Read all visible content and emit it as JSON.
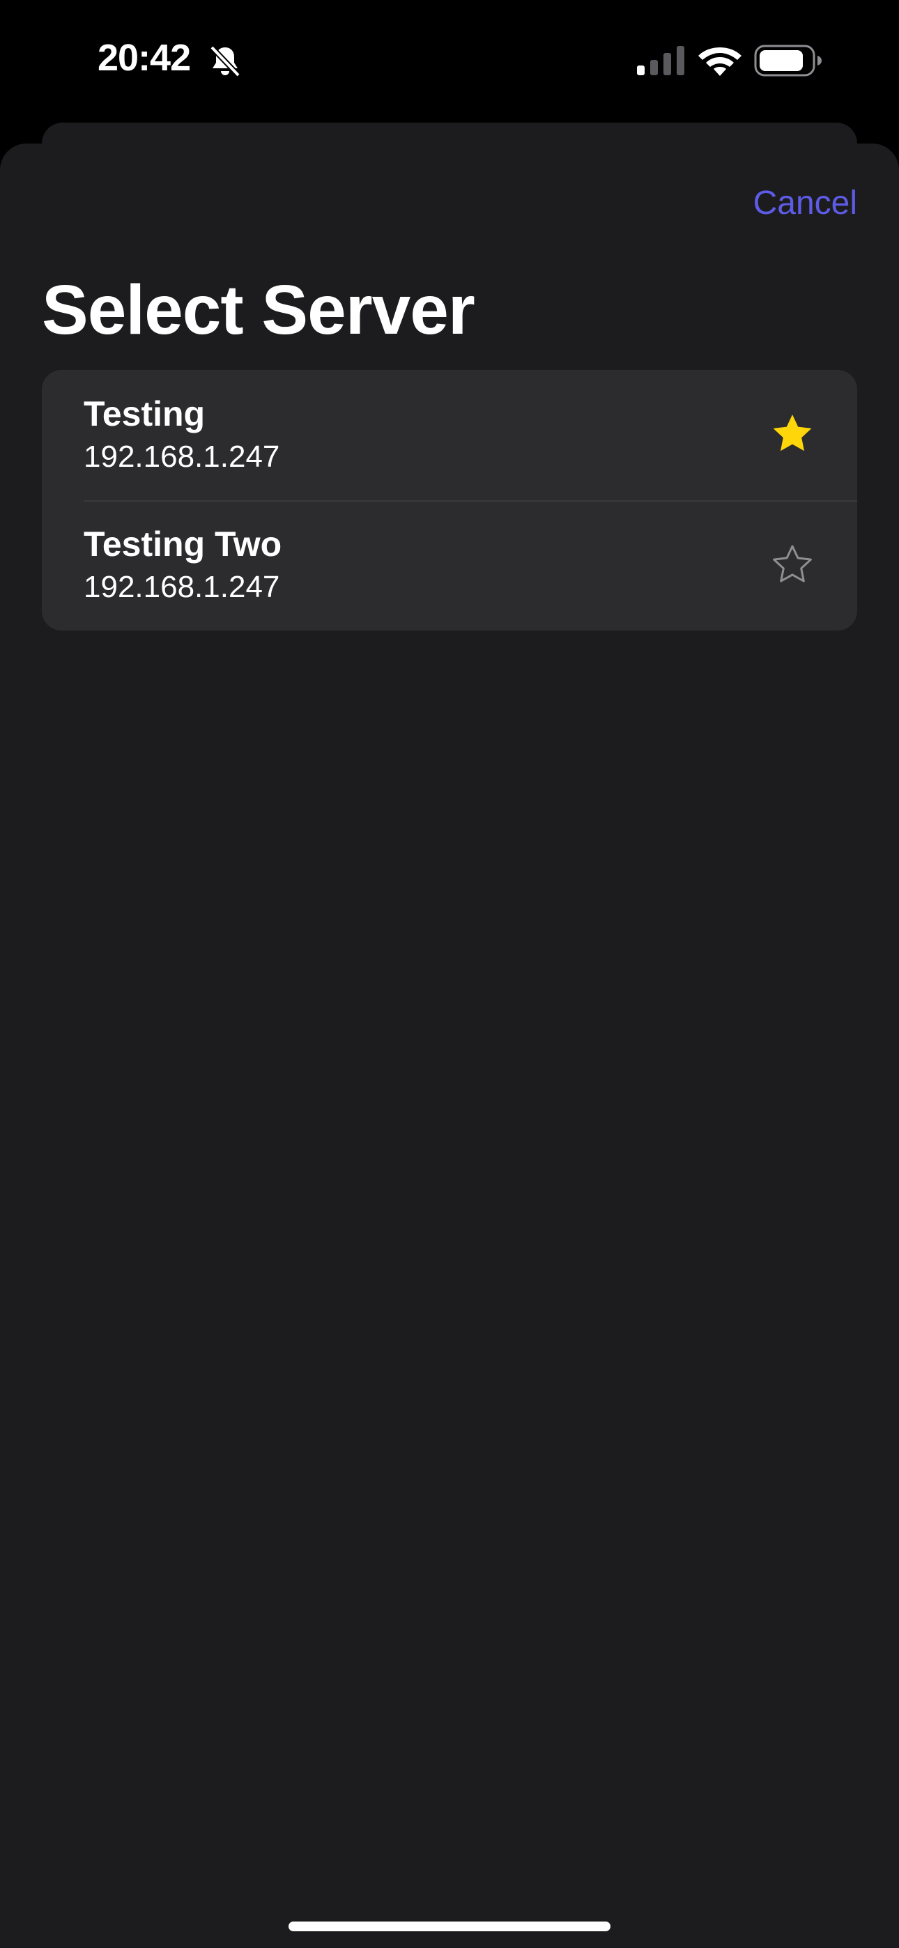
{
  "status_bar": {
    "time": "20:42",
    "icons": [
      "bell-slash-icon",
      "cellular-signal-icon",
      "wifi-icon",
      "battery-icon"
    ]
  },
  "sheet": {
    "cancel_label": "Cancel",
    "title": "Select Server"
  },
  "servers": [
    {
      "name": "Testing",
      "address": "192.168.1.247",
      "favorite": true
    },
    {
      "name": "Testing Two",
      "address": "192.168.1.247",
      "favorite": false
    }
  ],
  "colors": {
    "accent": "#5e5ce6",
    "favorite_star": "#ffd60a",
    "empty_star": "#8e8e93",
    "sheet_background": "#1c1c1e",
    "list_background": "#2c2c2e"
  }
}
